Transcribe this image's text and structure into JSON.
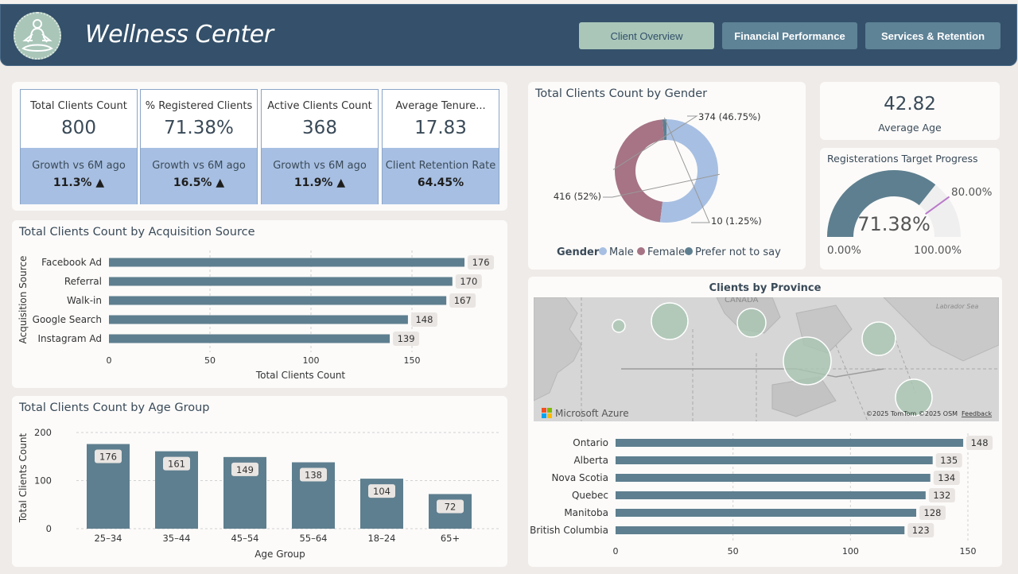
{
  "header": {
    "title": "Wellness Center",
    "nav": [
      "Client Overview",
      "Financial Performance",
      "Services & Retention"
    ]
  },
  "colors": {
    "header": "#34506a",
    "accent": "#a9c6b9",
    "bar": "#5e7f8f",
    "kpi_bottom": "#a7bfe2",
    "male": "#a7bfe2",
    "female": "#a67485",
    "prefer_not": "#5e7f8f"
  },
  "kpis": [
    {
      "label": "Total Clients Count",
      "value": "800",
      "sub_label": "Growth vs 6M ago",
      "sub_value": "11.3% ▲"
    },
    {
      "label": "% Registered Clients",
      "value": "71.38%",
      "sub_label": "Growth vs 6M ago",
      "sub_value": "16.5% ▲"
    },
    {
      "label": "Active Clients Count",
      "value": "368",
      "sub_label": "Growth vs 6M ago",
      "sub_value": "11.9% ▲"
    },
    {
      "label": "Average Tenure...",
      "value": "17.83",
      "sub_label": "Client Retention Rate",
      "sub_value": "64.45%"
    }
  ],
  "average_age": {
    "value": "42.82",
    "label": "Average Age"
  },
  "gauge": {
    "title": "Registerations Target Progress",
    "value_label": "71.38%",
    "target_label": "80.00%",
    "min_label": "0.00%",
    "max_label": "100.00%",
    "value": 71.38,
    "target": 80
  },
  "map": {
    "title": "Clients by Province",
    "labels": {
      "country": "CANADA",
      "sea": "Labrador Sea",
      "brand": "Microsoft Azure",
      "attribution": "©2025 TomTom  ©2025 OSM",
      "feedback": "Feedback"
    }
  },
  "chart_data": [
    {
      "type": "bar",
      "orientation": "horizontal",
      "title": "Total Clients Count by Acquisition Source",
      "xlabel": "Total Clients Count",
      "ylabel": "Acquisition Source",
      "categories": [
        "Facebook Ad",
        "Referral",
        "Walk-in",
        "Google Search",
        "Instagram Ad"
      ],
      "values": [
        176,
        170,
        167,
        148,
        139
      ],
      "xticks": [
        "0",
        "50",
        "100",
        "150"
      ],
      "xlim": [
        0,
        180
      ]
    },
    {
      "type": "bar",
      "orientation": "vertical",
      "title": "Total Clients Count by Age Group",
      "xlabel": "Age Group",
      "ylabel": "Total Clients Count",
      "categories": [
        "25–34",
        "35–44",
        "45–54",
        "55–64",
        "18–24",
        "65+"
      ],
      "values": [
        176,
        161,
        149,
        138,
        104,
        72
      ],
      "yticks": [
        "0",
        "100",
        "200"
      ],
      "ylim": [
        0,
        200
      ]
    },
    {
      "type": "pie",
      "title": "Total Clients Count by Gender",
      "legend_title": "Gender",
      "categories": [
        "Male",
        "Female",
        "Prefer not to say"
      ],
      "values": [
        416,
        374,
        10
      ],
      "data_labels": [
        "416 (52%)",
        "374 (46.75%)",
        "10 (1.25%)"
      ]
    },
    {
      "type": "bar",
      "orientation": "horizontal",
      "title": "Clients by Province",
      "categories": [
        "Ontario",
        "Alberta",
        "Nova Scotia",
        "Quebec",
        "Manitoba",
        "British Columbia"
      ],
      "values": [
        148,
        135,
        134,
        132,
        128,
        123
      ],
      "xticks": [
        "0",
        "50",
        "100",
        "150"
      ],
      "xlim": [
        0,
        150
      ]
    }
  ]
}
